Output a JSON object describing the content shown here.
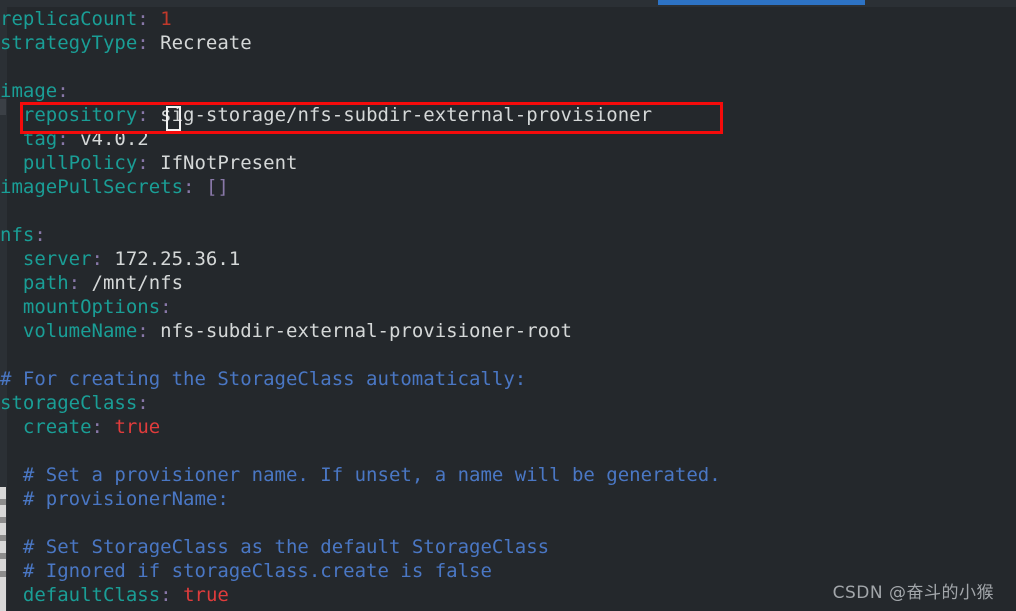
{
  "window": {
    "background_color": "#24282c",
    "chrome_color": "#2b3035",
    "active_tab_indicator_color": "#2d73c5"
  },
  "highlight": {
    "name": "repository-line-highlight",
    "color": "#f50b0b",
    "target_line": "repository: sig-storage/nfs-subdir-external-provisioner"
  },
  "cursor": {
    "name": "text-cursor-block",
    "color": "#f2f2f2",
    "after_text": "repository:"
  },
  "watermark": {
    "text": "CSDN @奋斗的小猴"
  },
  "editor": {
    "file_kind": "yaml",
    "lines": [
      {
        "indent": 0,
        "tokens": [
          {
            "t": "key",
            "v": "replicaCount"
          },
          {
            "t": "punct",
            "v": ":"
          },
          {
            "t": "val",
            "v": " "
          },
          {
            "t": "num",
            "v": "1"
          }
        ]
      },
      {
        "indent": 0,
        "tokens": [
          {
            "t": "key",
            "v": "strategyType"
          },
          {
            "t": "punct",
            "v": ":"
          },
          {
            "t": "val",
            "v": " Recreate"
          }
        ]
      },
      {
        "indent": 0,
        "tokens": []
      },
      {
        "indent": 0,
        "tokens": [
          {
            "t": "key",
            "v": "image"
          },
          {
            "t": "punct",
            "v": ":"
          }
        ]
      },
      {
        "indent": 2,
        "tokens": [
          {
            "t": "key",
            "v": "repository"
          },
          {
            "t": "punct",
            "v": ":"
          },
          {
            "t": "val",
            "v": " sig-storage/nfs-subdir-external-provisioner"
          }
        ]
      },
      {
        "indent": 2,
        "tokens": [
          {
            "t": "key",
            "v": "tag"
          },
          {
            "t": "punct",
            "v": ":"
          },
          {
            "t": "val",
            "v": " v4.0.2"
          }
        ]
      },
      {
        "indent": 2,
        "tokens": [
          {
            "t": "key",
            "v": "pullPolicy"
          },
          {
            "t": "punct",
            "v": ":"
          },
          {
            "t": "val",
            "v": " IfNotPresent"
          }
        ]
      },
      {
        "indent": 0,
        "tokens": [
          {
            "t": "key",
            "v": "imagePullSecrets"
          },
          {
            "t": "punct",
            "v": ":"
          },
          {
            "t": "val",
            "v": " "
          },
          {
            "t": "bracket",
            "v": "[]"
          }
        ]
      },
      {
        "indent": 0,
        "tokens": []
      },
      {
        "indent": 0,
        "tokens": [
          {
            "t": "key",
            "v": "nfs"
          },
          {
            "t": "punct",
            "v": ":"
          }
        ]
      },
      {
        "indent": 2,
        "tokens": [
          {
            "t": "key",
            "v": "server"
          },
          {
            "t": "punct",
            "v": ":"
          },
          {
            "t": "val",
            "v": " 172.25.36.1"
          }
        ]
      },
      {
        "indent": 2,
        "tokens": [
          {
            "t": "key",
            "v": "path"
          },
          {
            "t": "punct",
            "v": ":"
          },
          {
            "t": "val",
            "v": " /mnt/nfs"
          }
        ]
      },
      {
        "indent": 2,
        "tokens": [
          {
            "t": "key",
            "v": "mountOptions"
          },
          {
            "t": "punct",
            "v": ":"
          }
        ]
      },
      {
        "indent": 2,
        "tokens": [
          {
            "t": "key",
            "v": "volumeName"
          },
          {
            "t": "punct",
            "v": ":"
          },
          {
            "t": "val",
            "v": " nfs-subdir-external-provisioner-root"
          }
        ]
      },
      {
        "indent": 0,
        "tokens": []
      },
      {
        "indent": 0,
        "tokens": [
          {
            "t": "comment",
            "v": "# For creating the StorageClass automatically:"
          }
        ]
      },
      {
        "indent": 0,
        "tokens": [
          {
            "t": "key",
            "v": "storageClass"
          },
          {
            "t": "punct",
            "v": ":"
          }
        ]
      },
      {
        "indent": 2,
        "tokens": [
          {
            "t": "key",
            "v": "create"
          },
          {
            "t": "punct",
            "v": ":"
          },
          {
            "t": "val",
            "v": " "
          },
          {
            "t": "bool",
            "v": "true"
          }
        ]
      },
      {
        "indent": 0,
        "tokens": []
      },
      {
        "indent": 2,
        "tokens": [
          {
            "t": "comment",
            "v": "# Set a provisioner name. If unset, a name will be generated."
          }
        ]
      },
      {
        "indent": 2,
        "tokens": [
          {
            "t": "comment",
            "v": "# provisionerName:"
          }
        ]
      },
      {
        "indent": 0,
        "tokens": []
      },
      {
        "indent": 2,
        "tokens": [
          {
            "t": "comment",
            "v": "# Set StorageClass as the default StorageClass"
          }
        ]
      },
      {
        "indent": 2,
        "tokens": [
          {
            "t": "comment",
            "v": "# Ignored if storageClass.create is false"
          }
        ]
      },
      {
        "indent": 2,
        "tokens": [
          {
            "t": "key",
            "v": "defaultClass"
          },
          {
            "t": "punct",
            "v": ":"
          },
          {
            "t": "val",
            "v": " "
          },
          {
            "t": "bool",
            "v": "true"
          }
        ]
      }
    ]
  }
}
